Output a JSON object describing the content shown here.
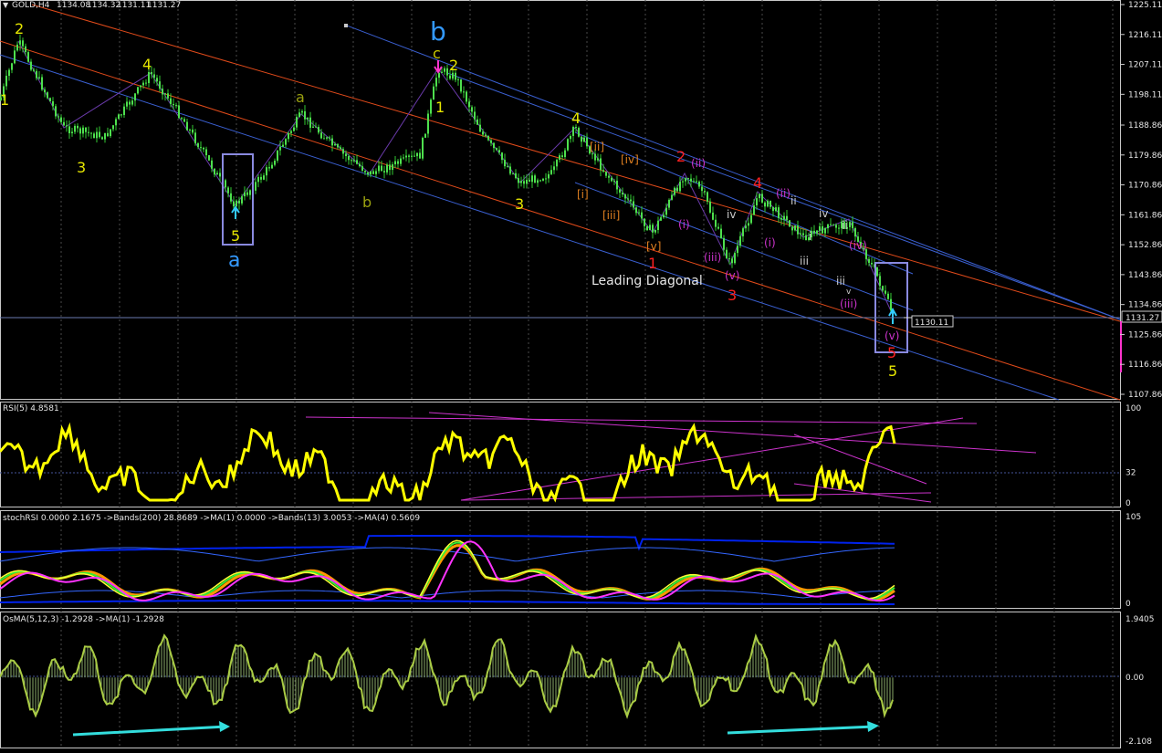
{
  "chart_data": [
    {
      "type": "candlestick",
      "title": "GOLD,H4",
      "ohlc": [
        "1134.08",
        "1134.32",
        "1131.11",
        "1131.27"
      ],
      "ylim": [
        1107.86,
        1225.11
      ],
      "yticks": [
        "1225.11",
        "1216.11",
        "1207.11",
        "1198.11",
        "1188.86",
        "1179.86",
        "1170.86",
        "1161.86",
        "1152.86",
        "1143.86",
        "1134.86",
        "1125.86",
        "1116.86",
        "1107.86"
      ],
      "current_price": "1131.27",
      "marker_price": "1130.11",
      "grid": true,
      "annotation_text": "Leading Diagonal",
      "wave_labels": [
        {
          "t": "2",
          "c": "#e6e600"
        },
        {
          "t": "4",
          "c": "#e6e600"
        },
        {
          "t": "3",
          "c": "#e6e600"
        },
        {
          "t": "5",
          "c": "#e6e600"
        },
        {
          "t": "a",
          "c": "#3399ff"
        },
        {
          "t": "a",
          "c": "#9aa010"
        },
        {
          "t": "b",
          "c": "#9aa010"
        },
        {
          "t": "b",
          "c": "#3399ff"
        },
        {
          "t": "c",
          "c": "#c8c800"
        },
        {
          "t": "2",
          "c": "#e6e600"
        },
        {
          "t": "1",
          "c": "#e6e600"
        },
        {
          "t": "3",
          "c": "#e6e600"
        },
        {
          "t": "4",
          "c": "#e6e600"
        },
        {
          "t": "[ii]",
          "c": "#e08020"
        },
        {
          "t": "[iv]",
          "c": "#e08020"
        },
        {
          "t": "[i]",
          "c": "#e08020"
        },
        {
          "t": "[iii]",
          "c": "#e08020"
        },
        {
          "t": "[v]",
          "c": "#e08020"
        },
        {
          "t": "1",
          "c": "#ff2020"
        },
        {
          "t": "2",
          "c": "#ff2020"
        },
        {
          "t": "(ii)",
          "c": "#cc33cc"
        },
        {
          "t": "(i)",
          "c": "#cc33cc"
        },
        {
          "t": "iv",
          "c": "#cccccc"
        },
        {
          "t": "(iii)",
          "c": "#cc33cc"
        },
        {
          "t": "(v)",
          "c": "#cc33cc"
        },
        {
          "t": "3",
          "c": "#ff2020"
        },
        {
          "t": "4",
          "c": "#ff2020"
        },
        {
          "t": "(ii)",
          "c": "#cc33cc"
        },
        {
          "t": "ii",
          "c": "#cccccc"
        },
        {
          "t": "(i)",
          "c": "#cc33cc"
        },
        {
          "t": "i",
          "c": "#cccccc"
        },
        {
          "t": "iii",
          "c": "#cccccc"
        },
        {
          "t": "iv",
          "c": "#cccccc"
        },
        {
          "t": "ii",
          "c": "#cccccc"
        },
        {
          "t": "(iv)",
          "c": "#cc33cc"
        },
        {
          "t": "iii",
          "c": "#cccccc"
        },
        {
          "t": "v",
          "c": "#cccccc"
        },
        {
          "t": "(iii)",
          "c": "#cc33cc"
        },
        {
          "t": "(v)",
          "c": "#cc33cc"
        },
        {
          "t": "5",
          "c": "#ff2020"
        },
        {
          "t": "5",
          "c": "#e6e600"
        },
        {
          "t": "1",
          "c": "#e6e600"
        }
      ]
    },
    {
      "type": "line",
      "title": "RSI(5) 4.8581",
      "ylim": [
        0,
        100
      ],
      "yticks": [
        "100",
        "32",
        "0"
      ]
    },
    {
      "type": "line",
      "title": "stochRSI 0.0000 2.1675  ->Bands(200) 28.8689  ->MA(1) 0.0000  ->Bands(13) 3.0053  ->MA(4) 0.5609",
      "ylim": [
        0,
        105
      ],
      "yticks": [
        "105",
        "0"
      ]
    },
    {
      "type": "bar",
      "title": "OsMA(5,12,3) -1.2928  ->MA(1) -1.2928",
      "ylim": [
        -2.108,
        1.9405
      ],
      "yticks": [
        "1.9405",
        "0.00",
        "-2.108"
      ]
    }
  ]
}
